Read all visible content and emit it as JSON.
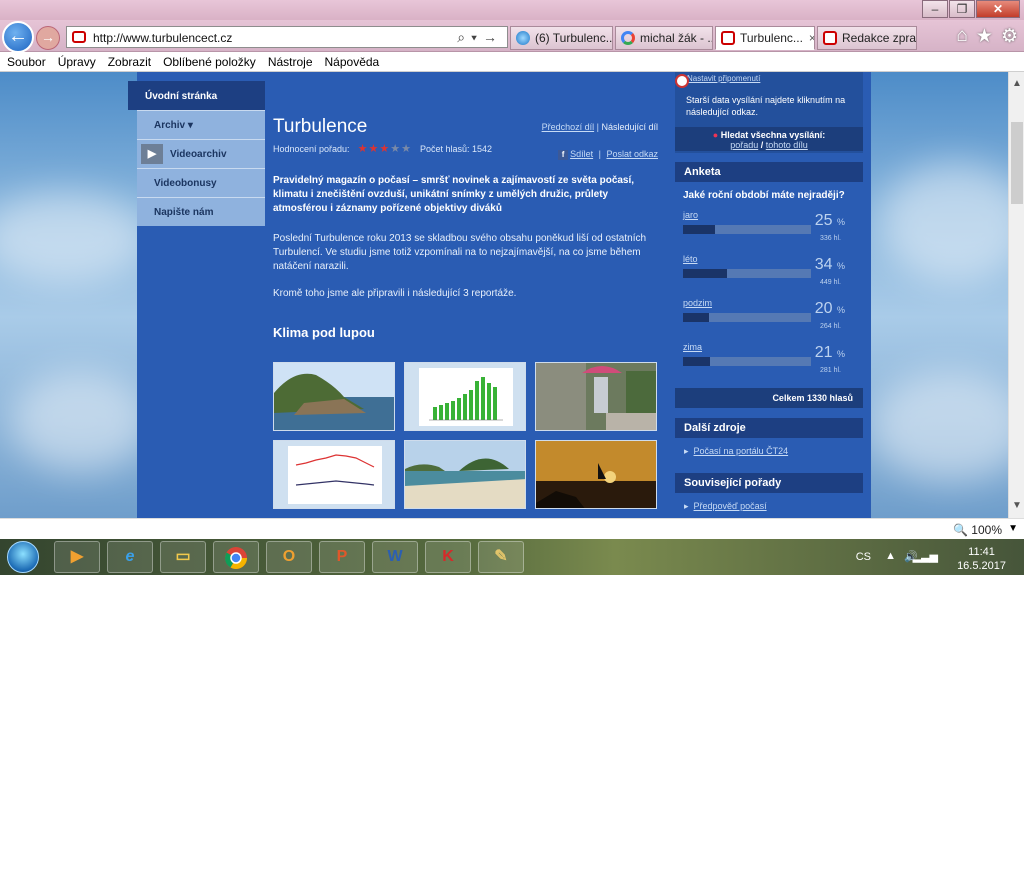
{
  "browser": {
    "url": "http://www.turbulencect.cz",
    "tabs": [
      {
        "label": "(6) Turbulenc...",
        "icon": "ie-icon"
      },
      {
        "label": "michal žák - ...",
        "icon": "google-icon"
      },
      {
        "label": "Turbulenc...",
        "icon": "ct-icon",
        "close": "×"
      },
      {
        "label": "Redakce zpra...",
        "icon": "ct-icon"
      }
    ],
    "menu": [
      "Soubor",
      "Úpravy",
      "Zobrazit",
      "Oblíbené položky",
      "Nástroje",
      "Nápověda"
    ],
    "zoom": "100%"
  },
  "site": {
    "nav": {
      "home": "Úvodní stránka",
      "archiv": "Archiv",
      "videoarchiv": "Videoarchiv",
      "videobonusy": "Videobonusy",
      "napiste": "Napište nám"
    },
    "article": {
      "title": "Turbulence",
      "prev": "Předchozí díl",
      "sep": "|",
      "next": "Následující díl",
      "rating_label": "Hodnocení pořadu:",
      "rating_value": 3,
      "rating_max": 5,
      "votes": "Počet hlasů: 1542",
      "share": "Sdílet",
      "send": "Poslat odkaz",
      "lead": "Pravidelný magazín o počasí – smršť novinek a zajímavostí ze světa počasí, klimatu i znečištění ovzduší, unikátní snímky z umělých družic, průlety atmosférou i záznamy pořízené objektivy diváků",
      "body1": "Poslední Turbulence roku 2013 se skladbou svého obsahu poněkud liší od ostatních Turbulencí. Ve studiu jsme totiž vzpomínali na to nejzajímavější, na co jsme během natáčení narazili.",
      "body2": "Kromě toho jsme ale připravili i následující 3 reportáže.",
      "section": "Klima pod lupou"
    },
    "right": {
      "remind": "Nastavit připomenutí",
      "old_data": "Starší data vysílání najdete kliknutím na následující odkaz.",
      "search_all": "Hledat všechna vysílání:",
      "search_show": "pořadu",
      "search_sep": "/",
      "search_part": "tohoto dílu",
      "poll_title": "Anketa",
      "poll_question": "Jaké roční období máte nejraději?",
      "options": [
        {
          "label": "jaro",
          "pct": "25",
          "votes": "336 hl.",
          "share": 0.25
        },
        {
          "label": "léto",
          "pct": "34",
          "votes": "449 hl.",
          "share": 0.34
        },
        {
          "label": "podzim",
          "pct": "20",
          "votes": "264 hl.",
          "share": 0.2
        },
        {
          "label": "zima",
          "pct": "21",
          "votes": "281 hl.",
          "share": 0.21
        }
      ],
      "pct_sign": "%",
      "total": "Celkem 1330 hlasů",
      "more_title": "Další zdroje",
      "more_link": "Počasí na portálu ČT24",
      "related_title": "Související pořady",
      "related_link": "Předpověď počasí"
    }
  },
  "taskbar": {
    "lang": "CS",
    "time": "11:41",
    "date": "16.5.2017"
  },
  "colors": {
    "site_blue": "#2a5cb3",
    "dark_blue": "#1d3f82",
    "nav_light": "#8fb2de"
  }
}
